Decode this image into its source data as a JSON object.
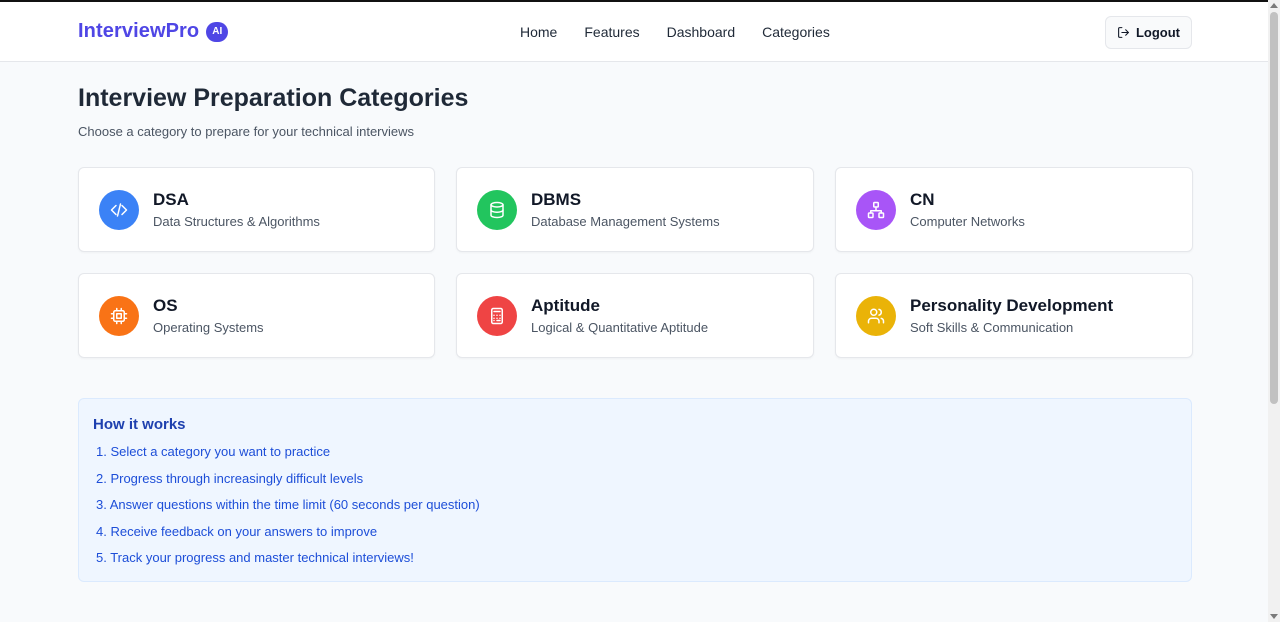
{
  "navbar": {
    "brand": "InterviewPro",
    "badge": "AI",
    "links": [
      "Home",
      "Features",
      "Dashboard",
      "Categories"
    ],
    "logout_label": "Logout"
  },
  "main": {
    "title": "Interview Preparation Categories",
    "subtitle": "Choose a category to prepare for your technical interviews"
  },
  "categories": [
    {
      "title": "DSA",
      "desc": "Data Structures & Algorithms",
      "icon": "code-icon",
      "color": "#3b82f6"
    },
    {
      "title": "DBMS",
      "desc": "Database Management Systems",
      "icon": "database-icon",
      "color": "#22c55e"
    },
    {
      "title": "CN",
      "desc": "Computer Networks",
      "icon": "network-icon",
      "color": "#a855f7"
    },
    {
      "title": "OS",
      "desc": "Operating Systems",
      "icon": "cpu-icon",
      "color": "#f97316"
    },
    {
      "title": "Aptitude",
      "desc": "Logical & Quantitative Aptitude",
      "icon": "calculator-icon",
      "color": "#ef4444"
    },
    {
      "title": "Personality Development",
      "desc": "Soft Skills & Communication",
      "icon": "users-icon",
      "color": "#eab308"
    }
  ],
  "how_it_works": {
    "title": "How it works",
    "steps": [
      "1. Select a category you want to practice",
      "2. Progress through increasingly difficult levels",
      "3. Answer questions within the time limit (60 seconds per question)",
      "4. Receive feedback on your answers to improve",
      "5. Track your progress and master technical interviews!"
    ]
  }
}
